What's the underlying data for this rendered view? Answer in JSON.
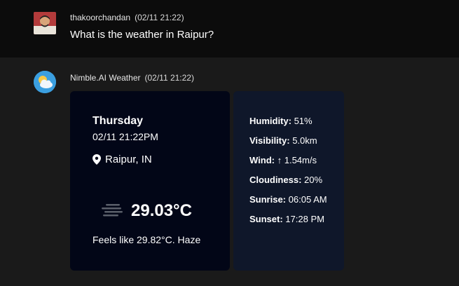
{
  "user_message": {
    "author": "thakoorchandan",
    "timestamp": "(02/11 21:22)",
    "text": "What is the weather in Raipur?"
  },
  "bot_message": {
    "author": "Nimble.AI Weather",
    "timestamp": "(02/11 21:22)"
  },
  "weather": {
    "day": "Thursday",
    "datetime": "02/11 21:22PM",
    "location": "Raipur, IN",
    "temperature": "29.03°C",
    "feels_like": "Feels like 29.82°C. Haze",
    "icon": "haze-icon",
    "stats": [
      {
        "label": "Humidity:",
        "value": "51%"
      },
      {
        "label": "Visibility:",
        "value": "5.0km"
      },
      {
        "label": "Wind:",
        "value": "↑ 1.54m/s"
      },
      {
        "label": "Cloudiness:",
        "value": "20%"
      },
      {
        "label": "Sunrise:",
        "value": "06:05 AM"
      },
      {
        "label": "Sunset:",
        "value": "17:28 PM"
      }
    ]
  },
  "colors": {
    "user_bg": "#0c0c0c",
    "bot_bg": "#1a1a1a",
    "card_left_bg": "#020617",
    "card_right_bg": "#0f172a"
  }
}
